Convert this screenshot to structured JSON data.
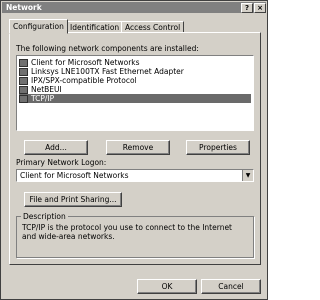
{
  "window": {
    "title": "Network",
    "help_btn": "?",
    "close_btn": "×"
  },
  "tabs": [
    {
      "label": "Configuration"
    },
    {
      "label": "Identification"
    },
    {
      "label": "Access Control"
    }
  ],
  "config": {
    "components_label": "The following network components are installed:",
    "components": [
      {
        "label": "Client for Microsoft Networks"
      },
      {
        "label": "Linksys LNE100TX Fast Ethernet Adapter"
      },
      {
        "label": "IPX/SPX-compatible Protocol"
      },
      {
        "label": "NetBEUI"
      },
      {
        "label": "TCP/IP",
        "selected": true
      }
    ],
    "add_btn": "Add...",
    "remove_btn": "Remove",
    "properties_btn": "Properties",
    "logon_label": "Primary Network Logon:",
    "logon_value": "Client for Microsoft Networks",
    "file_sharing_btn": "File and Print Sharing...",
    "description_title": "Description",
    "description_text": "TCP/IP is the protocol you use to connect to the Internet and wide-area networks."
  },
  "footer": {
    "ok_btn": "OK",
    "cancel_btn": "Cancel"
  }
}
